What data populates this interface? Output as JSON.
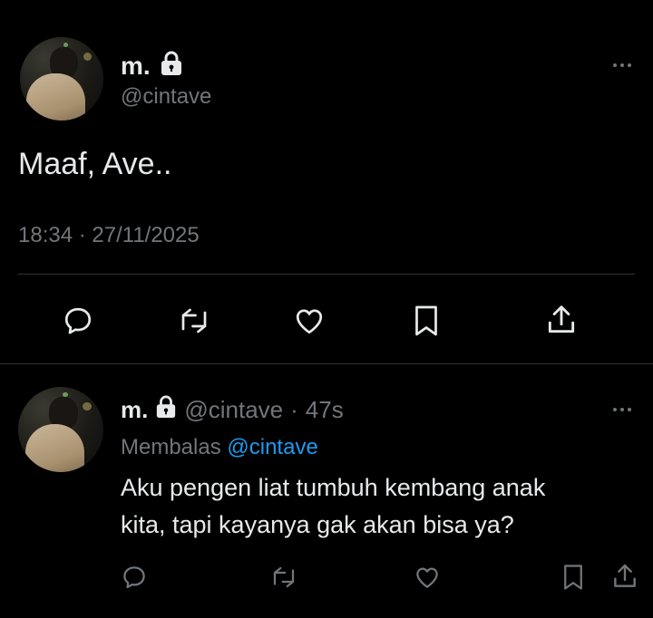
{
  "main_tweet": {
    "display_name": "m.",
    "handle": "@cintave",
    "text": "Maaf, Ave..",
    "timestamp": "18:34 · 27/11/2025",
    "icons": [
      "lock-icon",
      "more-icon",
      "reply-icon",
      "retweet-icon",
      "like-icon",
      "bookmark-icon",
      "share-icon"
    ]
  },
  "reply_tweet": {
    "display_name": "m.",
    "handle": "@cintave",
    "separator": "·",
    "time_ago": "47s",
    "replying_prefix": "Membalas",
    "replying_to": "@cintave",
    "text_line1": "Aku pengen liat tumbuh kembang anak",
    "text_line2": "kita, tapi kayanya gak akan bisa ya?"
  },
  "colors": {
    "background": "#000000",
    "text": "#e7e9ea",
    "muted": "#71767b",
    "link": "#1d9bf0",
    "divider": "#2f3336"
  }
}
